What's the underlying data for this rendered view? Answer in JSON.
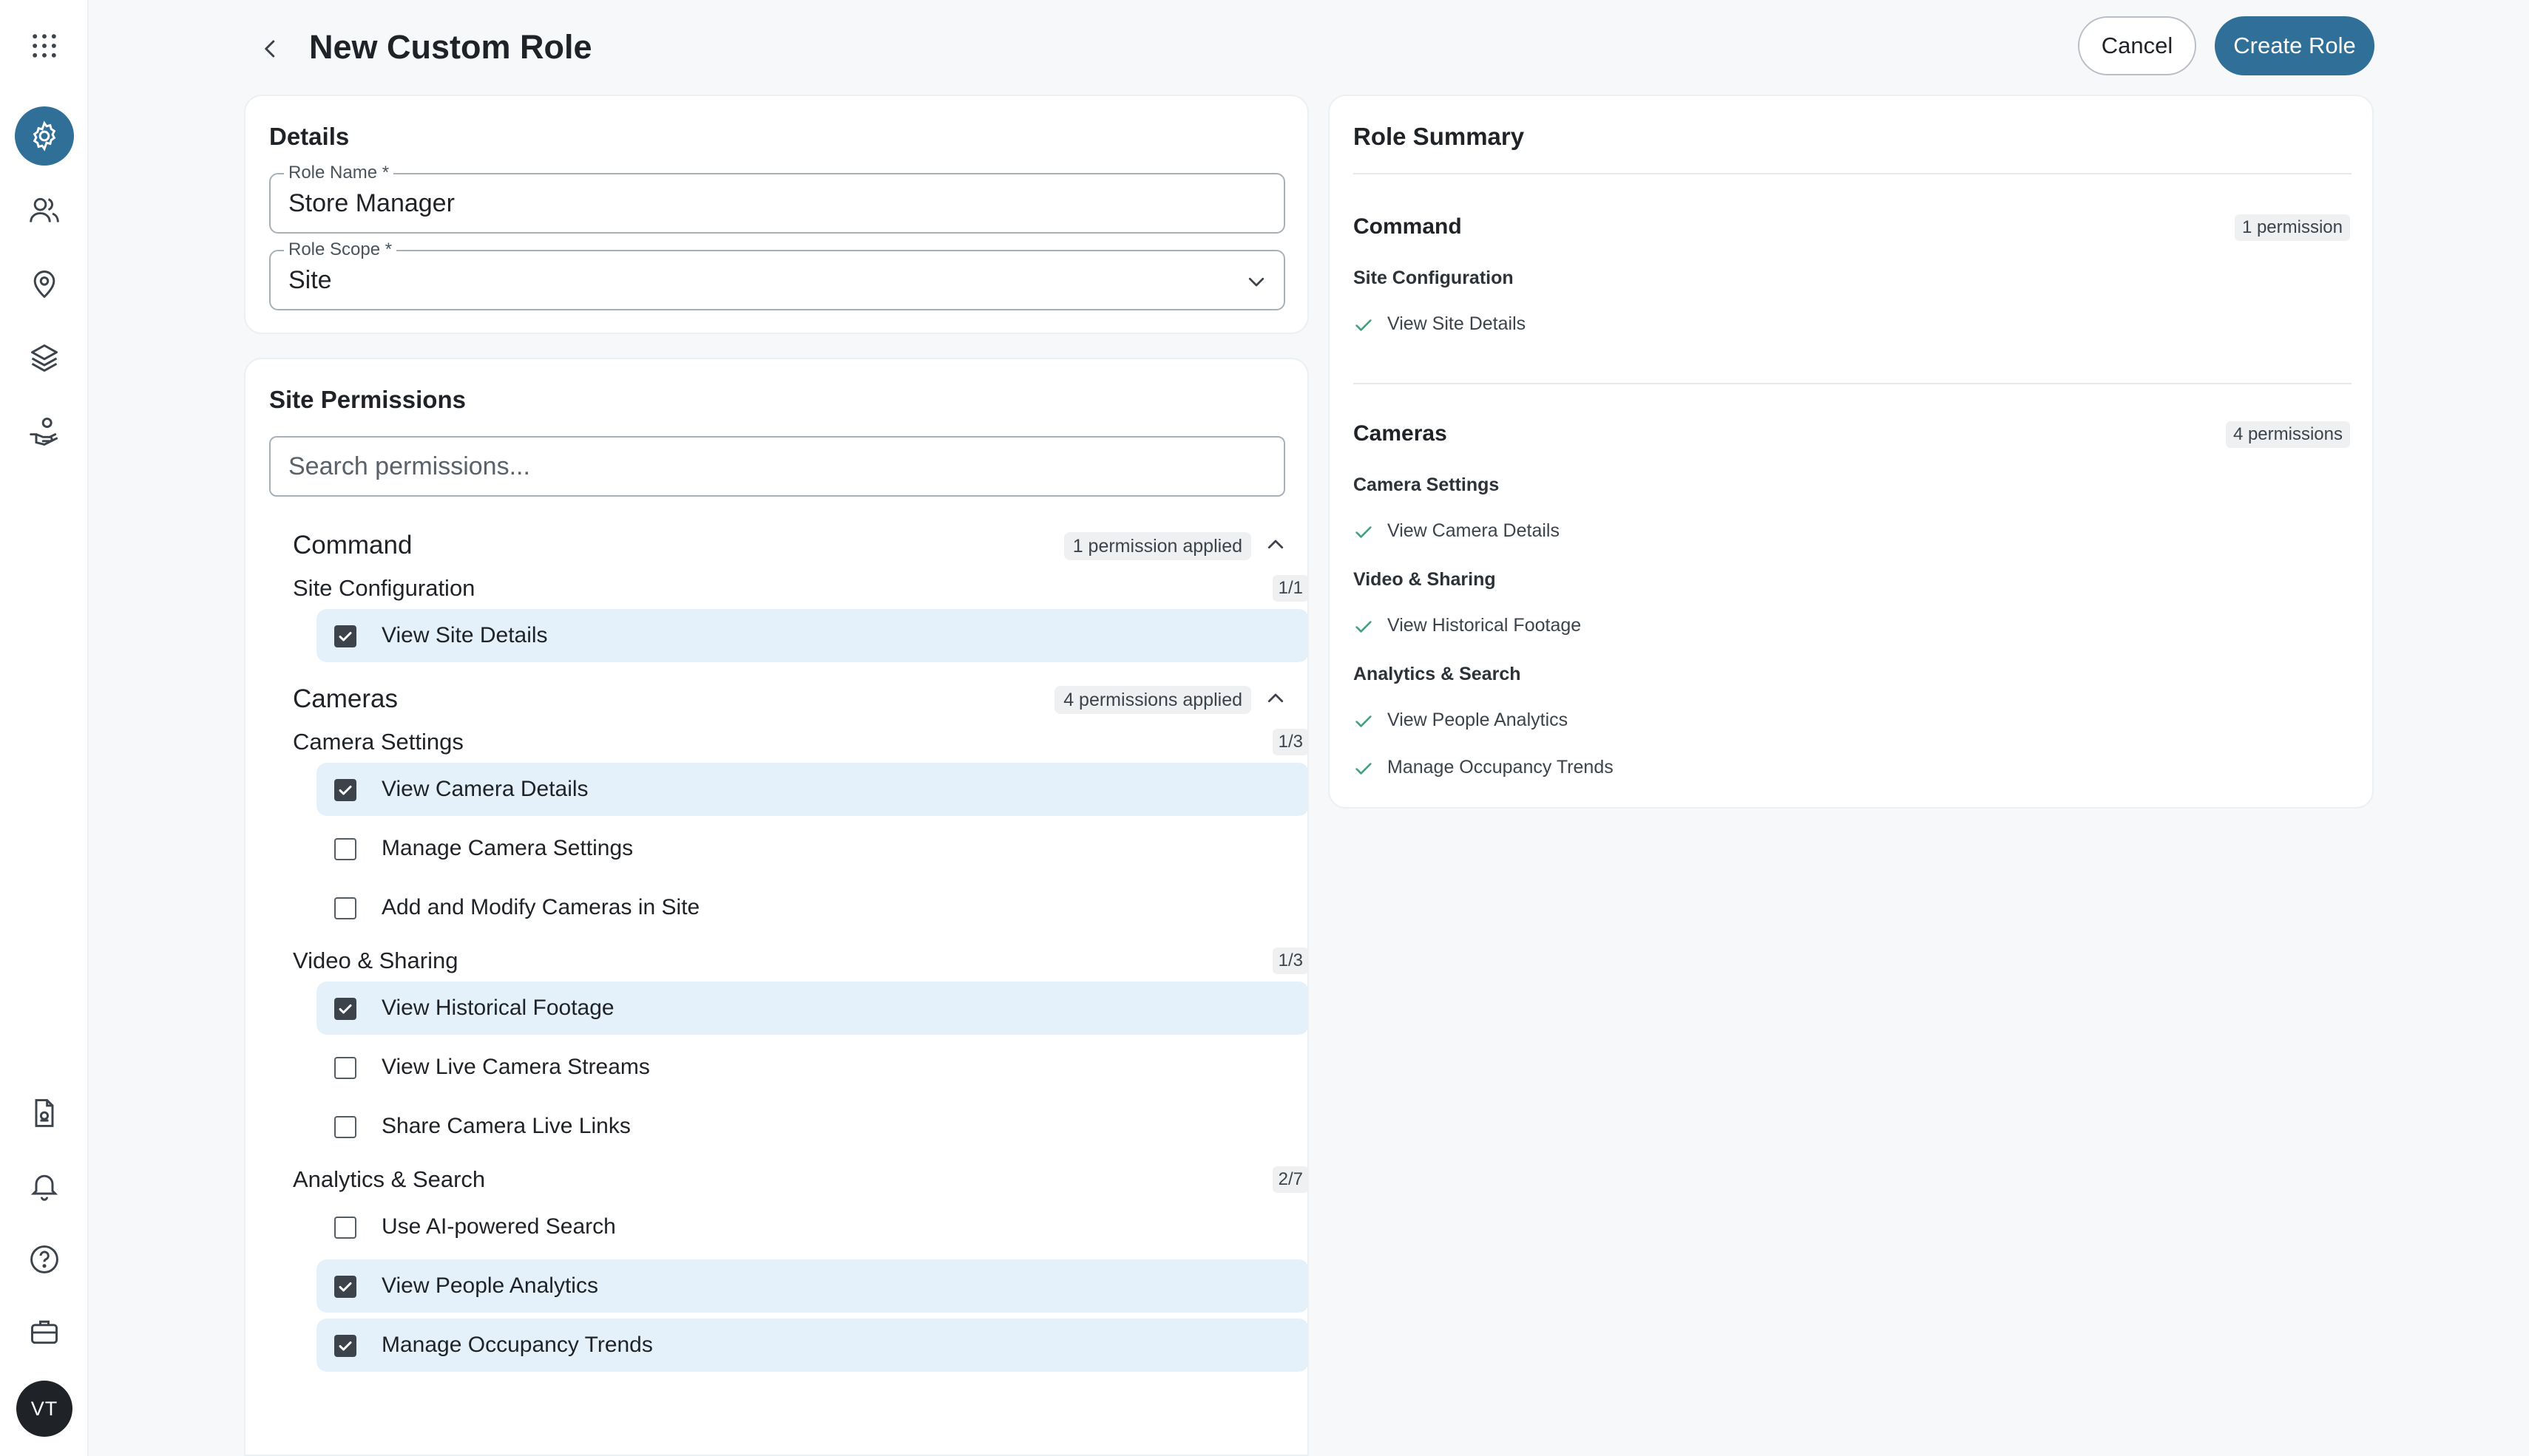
{
  "app": {
    "avatar_initials": "VT",
    "accent_color": "#2f6f98",
    "check_color": "#3aa57a"
  },
  "header": {
    "title": "New Custom Role",
    "cancel_label": "Cancel",
    "create_label": "Create Role"
  },
  "rail": {
    "top_icons": [
      "apps-grid-icon",
      "settings-gear-icon",
      "users-icon",
      "location-pin-icon",
      "layers-icon",
      "hand-person-icon"
    ],
    "bottom_icons": [
      "report-document-icon",
      "bell-icon",
      "help-icon",
      "briefcase-icon"
    ],
    "active": "settings-gear-icon"
  },
  "details": {
    "title": "Details",
    "role_name_label": "Role Name *",
    "role_name_value": "Store Manager",
    "role_scope_label": "Role Scope *",
    "role_scope_value": "Site"
  },
  "permissions": {
    "title": "Site Permissions",
    "search_placeholder": "Search permissions...",
    "groups": [
      {
        "name": "Command",
        "badge": "1 permission applied",
        "subgroups": [
          {
            "name": "Site Configuration",
            "count": "1/1",
            "items": [
              {
                "label": "View Site Details",
                "checked": true
              }
            ]
          }
        ]
      },
      {
        "name": "Cameras",
        "badge": "4 permissions applied",
        "subgroups": [
          {
            "name": "Camera Settings",
            "count": "1/3",
            "items": [
              {
                "label": "View Camera Details",
                "checked": true
              },
              {
                "label": "Manage Camera Settings",
                "checked": false
              },
              {
                "label": "Add and Modify Cameras in Site",
                "checked": false
              }
            ]
          },
          {
            "name": "Video & Sharing",
            "count": "1/3",
            "items": [
              {
                "label": "View Historical Footage",
                "checked": true
              },
              {
                "label": "View Live Camera Streams",
                "checked": false
              },
              {
                "label": "Share Camera Live Links",
                "checked": false
              }
            ]
          },
          {
            "name": "Analytics & Search",
            "count": "2/7",
            "items": [
              {
                "label": "Use AI-powered Search",
                "checked": false
              },
              {
                "label": "View People Analytics",
                "checked": true
              },
              {
                "label": "Manage Occupancy Trends",
                "checked": true
              }
            ]
          }
        ]
      }
    ]
  },
  "summary": {
    "title": "Role Summary",
    "groups": [
      {
        "name": "Command",
        "badge": "1 permission",
        "subgroups": [
          {
            "name": "Site Configuration",
            "items": [
              "View Site Details"
            ]
          }
        ]
      },
      {
        "name": "Cameras",
        "badge": "4 permissions",
        "subgroups": [
          {
            "name": "Camera Settings",
            "items": [
              "View Camera Details"
            ]
          },
          {
            "name": "Video & Sharing",
            "items": [
              "View Historical Footage"
            ]
          },
          {
            "name": "Analytics & Search",
            "items": [
              "View People Analytics",
              "Manage Occupancy Trends"
            ]
          }
        ]
      }
    ]
  }
}
